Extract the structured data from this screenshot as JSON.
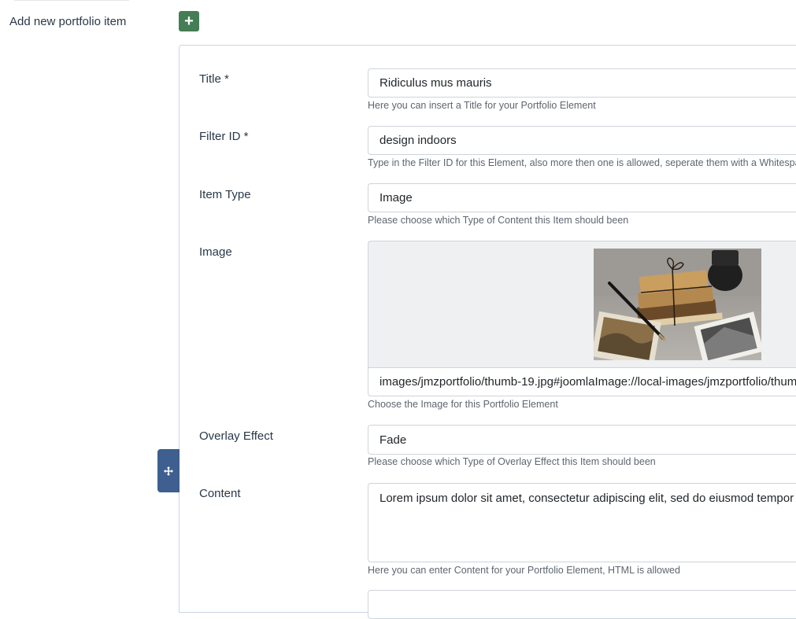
{
  "header": {
    "add_label": "Add new portfolio item",
    "add_button_symbol": "+"
  },
  "colors": {
    "add_button": "#457d54",
    "drag_handle": "#3e5f8f",
    "panel_border": "#c9d6e2"
  },
  "form": {
    "title": {
      "label": "Title *",
      "value": "Ridiculus mus mauris",
      "help": "Here you can insert a Title for your Portfolio Element"
    },
    "filter_id": {
      "label": "Filter ID *",
      "value": "design indoors",
      "help": "Type in the Filter ID for this Element, also more then one is allowed, seperate them with a Whitespa"
    },
    "item_type": {
      "label": "Item Type",
      "value": "Image",
      "help": "Please choose which Type of Content this Item should been"
    },
    "image": {
      "label": "Image",
      "path": "images/jmzportfolio/thumb-19.jpg#joomlaImage://local-images/jmzportfolio/thum",
      "help": "Choose the Image for this Portfolio Element"
    },
    "overlay_effect": {
      "label": "Overlay Effect",
      "value": "Fade",
      "help": "Please choose which Type of Overlay Effect this Item should been"
    },
    "content": {
      "label": "Content",
      "value": "Lorem ipsum dolor sit amet, consectetur adipiscing elit, sed do eiusmod tempor inci",
      "help": "Here you can enter Content for your Portfolio Element, HTML is allowed"
    }
  },
  "icons": {
    "drag": "move-arrows-icon",
    "add": "plus-icon"
  }
}
